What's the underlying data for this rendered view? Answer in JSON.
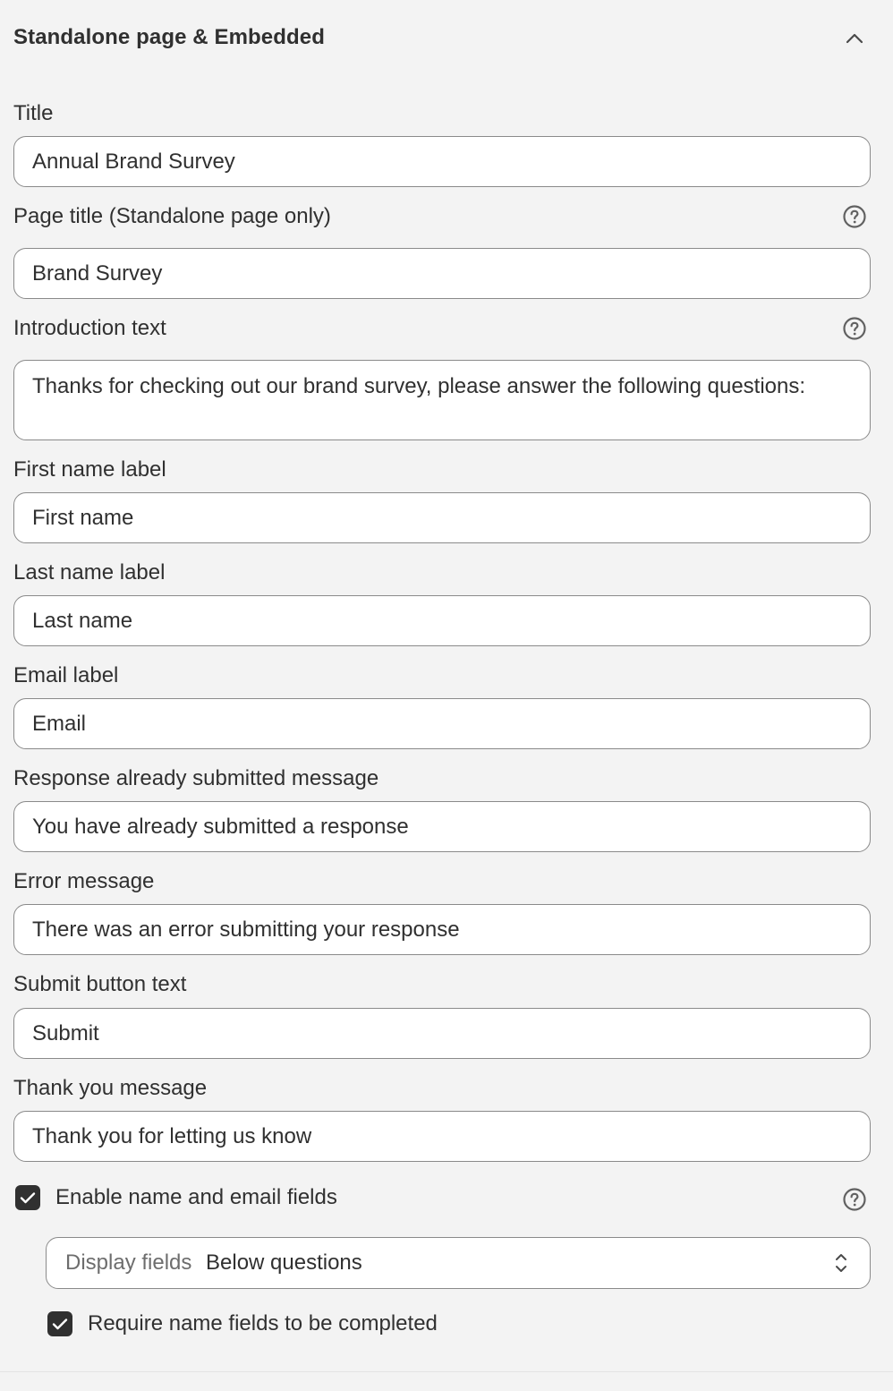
{
  "section": {
    "title": "Standalone page & Embedded"
  },
  "fields": [
    {
      "label": "Title",
      "value": "Annual Brand Survey"
    },
    {
      "label": "Page title (Standalone page only)",
      "value": "Brand Survey"
    },
    {
      "label": "Introduction text",
      "value": "Thanks for checking out our brand survey, please answer the following questions:"
    },
    {
      "label": "First name label",
      "value": "First name"
    },
    {
      "label": "Last name label",
      "value": "Last name"
    },
    {
      "label": "Email label",
      "value": "Email"
    },
    {
      "label": "Response already submitted message",
      "value": "You have already submitted a response"
    },
    {
      "label": "Error message",
      "value": "There was an error submitting your response"
    },
    {
      "label": "Submit button text",
      "value": "Submit"
    },
    {
      "label": "Thank you message",
      "value": "Thank you for letting us know"
    }
  ],
  "enable_fields": {
    "label": "Enable name and email fields",
    "checked": true
  },
  "display_fields": {
    "prefix": "Display fields",
    "value": "Below questions"
  },
  "require_fields": {
    "label": "Require name fields to be completed",
    "checked": true
  },
  "icons": {
    "collapse": "chevron-up-icon",
    "help": "question-circle-icon",
    "check": "checkmark-icon",
    "select": "select-chevron-icon"
  }
}
